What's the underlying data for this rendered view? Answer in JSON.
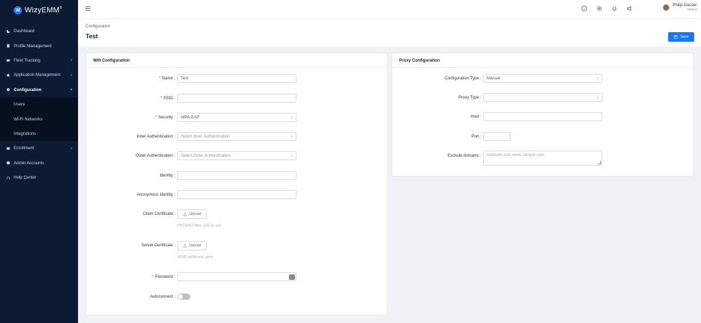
{
  "app": {
    "logo_letter": "W",
    "name": "WizyEMM",
    "registered": "®"
  },
  "sidebar": {
    "items": [
      {
        "label": "Dashboard",
        "icon": "dashboard-icon"
      },
      {
        "label": "Profile Management",
        "icon": "profile-icon"
      },
      {
        "label": "Fleet Tracking",
        "icon": "fleet-icon",
        "chevron": "∨"
      },
      {
        "label": "Application Management",
        "icon": "apps-icon",
        "chevron": "∨"
      },
      {
        "label": "Configuration",
        "icon": "gear-icon",
        "chevron": "∧"
      }
    ],
    "sub_items": [
      {
        "label": "Users"
      },
      {
        "label": "Wi-Fi Networks"
      },
      {
        "label": "Integrations"
      }
    ],
    "items_after": [
      {
        "label": "Enrollment",
        "icon": "enrollment-icon",
        "chevron": "∨"
      },
      {
        "label": "Admin Accounts",
        "icon": "admin-icon"
      },
      {
        "label": "Help Center",
        "icon": "headset-icon"
      }
    ]
  },
  "user": {
    "name": "Philip Gasser",
    "role": "staging"
  },
  "header": {
    "breadcrumb": "Configuration",
    "title": "Test",
    "save_label": "Save"
  },
  "wifi": {
    "title": "Wifi Configuration",
    "name_label": "Name :",
    "name_value": "Test",
    "ssid_label": "SSID :",
    "security_label": "Security :",
    "security_value": "WPA-EAP",
    "inner_label": "Inner Authentication :",
    "inner_placeholder": "Select Inner Authentication",
    "outer_label": "Outer Authentication :",
    "outer_placeholder": "Select Outer Authentication",
    "identity_label": "Identity :",
    "anon_label": "Anonymous Identity :",
    "client_cert_label": "Client Certificate :",
    "client_upload": "Upload",
    "client_hint": "PKCS#12 files .p12 or .pfx",
    "server_cert_label": "Server Certificate :",
    "server_upload": "Upload",
    "server_hint": "X509 certificate .pem",
    "password_label": "Password :",
    "autoconnect_label": "Autoconnect :"
  },
  "proxy": {
    "title": "Proxy Configuration",
    "config_type_label": "Configuration Type :",
    "config_type_value": "Manual",
    "proxy_type_label": "Proxy Type :",
    "host_label": "Host :",
    "port_label": "Port :",
    "exclude_label": "Exclude domains :",
    "exclude_placeholder": "example.com,www.sample.com"
  },
  "colors": {
    "sidebar_bg": "#0c1b33",
    "accent": "#1677ff",
    "required": "#e0302a"
  }
}
